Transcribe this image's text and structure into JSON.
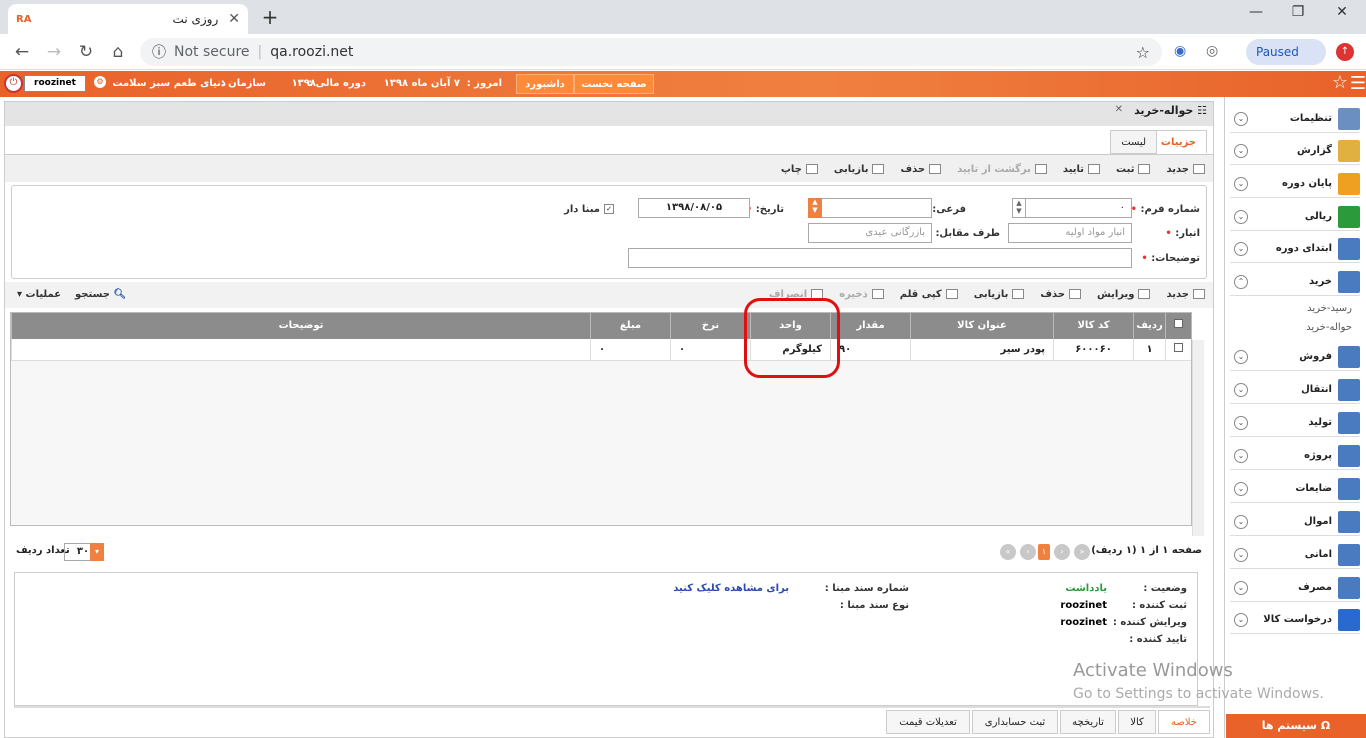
{
  "browser": {
    "tab_logo": "RA",
    "tab_title": "روزی نت",
    "not_secure": "Not secure",
    "url": "qa.roozi.net",
    "paused": "Paused"
  },
  "header": {
    "user": "roozinet",
    "org_label": "سازمان :",
    "org_value": "دنیای طعم سبز سلامت",
    "fiscal_label": "دوره مالی :",
    "fiscal_value": "۱۳۹۸",
    "today_label": "امروز :",
    "today_value": "۷ آبان ماه ۱۳۹۸",
    "dashboard": "داشبورد",
    "first_page": "صفحه نخست"
  },
  "sidebar": {
    "items": [
      {
        "label": "تنظیمات",
        "icon": "settings-icon",
        "color": "#6a8fc0"
      },
      {
        "label": "گزارش",
        "icon": "clipboard-icon",
        "color": "#e0b040"
      },
      {
        "label": "پایان دوره",
        "icon": "folders-icon",
        "color": "#f0a020"
      },
      {
        "label": "ریالی",
        "icon": "coins-icon",
        "color": "#2a9a3a"
      },
      {
        "label": "ابتدای دوره",
        "icon": "table-icon",
        "color": "#4a7ac0"
      },
      {
        "label": "خرید",
        "icon": "table-icon",
        "color": "#4a7ac0"
      },
      {
        "label": "فروش",
        "icon": "table-icon",
        "color": "#4a7ac0"
      },
      {
        "label": "انتقال",
        "icon": "table-icon",
        "color": "#4a7ac0"
      },
      {
        "label": "تولید",
        "icon": "table-icon",
        "color": "#4a7ac0"
      },
      {
        "label": "پروژه",
        "icon": "table-icon",
        "color": "#4a7ac0"
      },
      {
        "label": "ضایعات",
        "icon": "table-icon",
        "color": "#4a7ac0"
      },
      {
        "label": "اموال",
        "icon": "table-icon",
        "color": "#4a7ac0"
      },
      {
        "label": "امانی",
        "icon": "table-icon",
        "color": "#4a7ac0"
      },
      {
        "label": "مصرف",
        "icon": "table-icon",
        "color": "#4a7ac0"
      },
      {
        "label": "درخواست کالا",
        "icon": "plus-icon",
        "color": "#2a6ad0"
      }
    ],
    "sub_items": [
      "رسید-خرید",
      "حواله-خرید"
    ],
    "system_button": "سیستم ها"
  },
  "main": {
    "tab_title": "حواله-خرید",
    "subtabs": [
      "جزییات",
      "لیست"
    ],
    "toolbar": [
      "جدید",
      "ثبت",
      "تایید",
      "برگشت از تایید",
      "حذف",
      "بازیابی",
      "چاپ"
    ],
    "form": {
      "form_no_label": "شماره فرم:",
      "form_no_value": "۰",
      "sub_label": "فرعی:",
      "date_label": "تاریخ:",
      "date_value": "۱۳۹۸/۰۸/۰۵",
      "base_label": "مبنا دار",
      "warehouse_label": "انبار:",
      "warehouse_value": "انبار مواد اولیه",
      "party_label": "طرف مقابل:",
      "party_value": "بازرگانی عیدی",
      "desc_label": "توضیحات:"
    },
    "grid_toolbar": [
      "جدید",
      "ویرایش",
      "حذف",
      "بازیابی",
      "کپی قلم",
      "ذخیره",
      "انصراف"
    ],
    "grid_search": "جستجو",
    "grid_ops": "عملیات",
    "columns": [
      "ردیف",
      "کد کالا",
      "عنوان کالا",
      "مقدار",
      "واحد",
      "نرخ",
      "مبلغ",
      "توضیحات"
    ],
    "rows": [
      {
        "row": "۱",
        "code": "۶۰۰۰۶۰",
        "title": "پودر سیر",
        "qty": "۹۰",
        "unit": "کیلوگرم",
        "rate": "۰",
        "amount": "۰",
        "desc": ""
      }
    ],
    "pager_text": "صفحه ۱ از ۱ (۱ ردیف)",
    "page_no": "۱",
    "page_size": "۳۰",
    "page_size_label": "تعداد ردیف",
    "summary": {
      "status_label": "وضعیت :",
      "status_value": "یادداشت",
      "creator_label": "ثبت کننده :",
      "creator_value": "roozinet",
      "editor_label": "ویرایش کننده :",
      "editor_value": "roozinet",
      "approver_label": "تایید کننده :",
      "base_doc_label": "شماره سند مبنا :",
      "base_doc_type_label": "نوع سند مبنا :",
      "view_link": "برای مشاهده کلیک کنید"
    },
    "bottom_tabs": [
      "خلاصه",
      "کالا",
      "تاریخچه",
      "ثبت حسابداری",
      "تعدیلات قیمت"
    ]
  },
  "watermark": {
    "line1": "Activate Windows",
    "line2": "Go to Settings to activate Windows."
  }
}
